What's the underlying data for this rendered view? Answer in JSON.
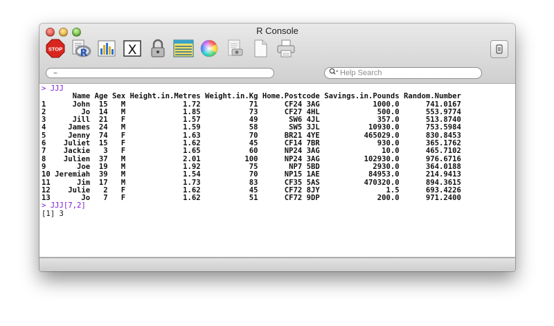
{
  "window": {
    "title": "R Console"
  },
  "toolbar": {
    "tools": [
      {
        "name": "stop-icon",
        "label": "STOP"
      },
      {
        "name": "r-source-icon"
      },
      {
        "name": "bar-chart-icon"
      },
      {
        "name": "x11-icon",
        "label": "X"
      },
      {
        "name": "lock-icon"
      },
      {
        "name": "data-editor-icon"
      },
      {
        "name": "color-wheel-icon"
      },
      {
        "name": "print-preview-icon"
      },
      {
        "name": "new-document-icon"
      },
      {
        "name": "printer-icon"
      }
    ]
  },
  "directory": {
    "value": "~"
  },
  "search": {
    "placeholder": "Help Search"
  },
  "console": {
    "command1": "> JJJ",
    "header": "       Name Age Sex Height.in.Metres Weight.in.Kg Home.Postcode Savings.in.Pounds Random.Number",
    "rows": [
      "1      John  15   M             1.72           71      CF24 3AG            1000.0      741.0167",
      "2        Jo  14   M             1.85           73      CF27 4HL             500.0      553.9774",
      "3      Jill  21   F             1.57           49       SW6 4JL             357.0      513.8740",
      "4     James  24   M             1.59           58       SW5 3JL           10930.0      753.5984",
      "5     Jenny  74   F             1.63           70      BR21 4YE          465029.0      830.8453",
      "6    Juliet  15   F             1.62           45      CF14 7BR             930.0      365.1762",
      "7    Jackie   3   F             1.65           60      NP24 3AG              10.0      465.7102",
      "8    Julien  37   M             2.01          100      NP24 3AG          102930.0      976.6716",
      "9       Joe  19   M             1.92           75       NP7 5BD            2930.0      364.0188",
      "10 Jeremiah  39   M             1.54           70      NP15 1AE           84953.0      214.9413",
      "11      Jim  17   M             1.73           83      CF35 5AS          470320.0      894.3615",
      "12    Julie   2   F             1.62           45      CF72 8JY               1.5      693.4226",
      "13       Jo   7   F             1.62           51      CF72 9DP             200.0      971.2400"
    ],
    "command2": "> JJJ[7,2]",
    "result": "[1] 3"
  }
}
